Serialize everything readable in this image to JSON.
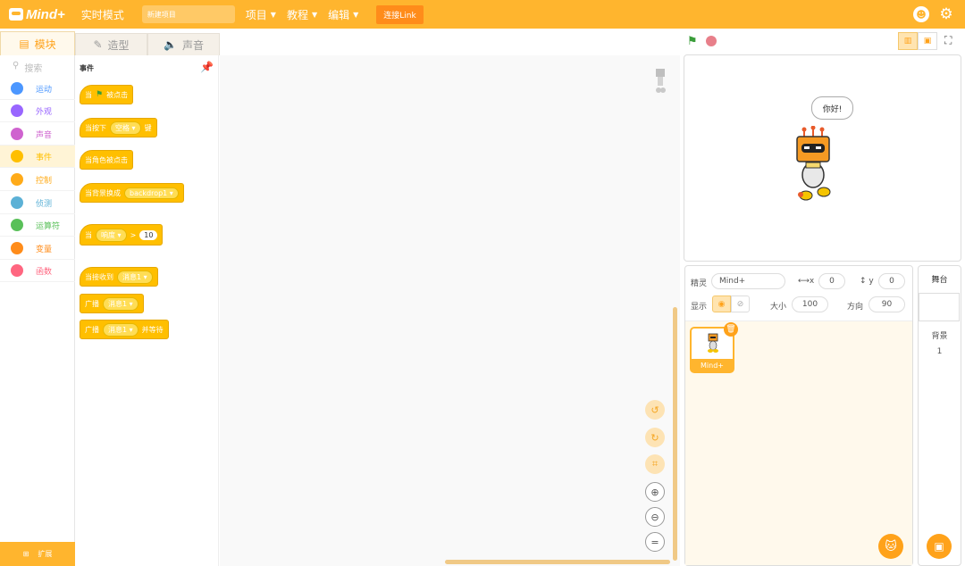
{
  "app": {
    "logo_text": "Mind+",
    "mode_label": "实时模式",
    "project_name": "新建项目",
    "connect_label": "连接Link"
  },
  "menus": [
    {
      "label": "项目"
    },
    {
      "label": "教程"
    },
    {
      "label": "编辑"
    }
  ],
  "tabs": {
    "blocks": "模块",
    "costumes": "造型",
    "sounds": "声音"
  },
  "search_placeholder": "搜索",
  "categories": [
    {
      "label": "运动",
      "color": "#4c97ff"
    },
    {
      "label": "外观",
      "color": "#9966ff"
    },
    {
      "label": "声音",
      "color": "#cf63cf"
    },
    {
      "label": "事件",
      "color": "#ffbf00"
    },
    {
      "label": "控制",
      "color": "#ffab19"
    },
    {
      "label": "侦测",
      "color": "#5cb1d6"
    },
    {
      "label": "运算符",
      "color": "#59c059"
    },
    {
      "label": "变量",
      "color": "#ff8c1a"
    },
    {
      "label": "函数",
      "color": "#ff6680"
    }
  ],
  "extensions_label": "扩展",
  "palette": {
    "title": "事件",
    "blocks": {
      "flag_prefix": "当",
      "flag_suffix": "被点击",
      "key_prefix": "当按下",
      "key_value": "空格",
      "key_suffix": "键",
      "sprite_clicked": "当角色被点击",
      "backdrop_prefix": "当背景换成",
      "backdrop_value": "backdrop1",
      "gt_prefix": "当",
      "gt_option": "响度",
      "gt_op": ">",
      "gt_value": "10",
      "receive_prefix": "当接收到",
      "receive_value": "消息1",
      "broadcast_prefix": "广播",
      "broadcast_value": "消息1",
      "broadcast_wait_prefix": "广播",
      "broadcast_wait_value": "消息1",
      "broadcast_wait_suffix": "并等待"
    }
  },
  "stage": {
    "speech": "你好!"
  },
  "sprite_info": {
    "sprite_label": "精灵",
    "sprite_name": "Mind+",
    "x_label": "x",
    "x_value": "0",
    "y_label": "y",
    "y_value": "0",
    "show_label": "显示",
    "size_label": "大小",
    "size_value": "100",
    "direction_label": "方向",
    "direction_value": "90"
  },
  "sprite_list": [
    {
      "name": "Mind+"
    }
  ],
  "stage_panel": {
    "title": "舞台",
    "backdrop_label": "背景",
    "backdrop_count": "1"
  }
}
